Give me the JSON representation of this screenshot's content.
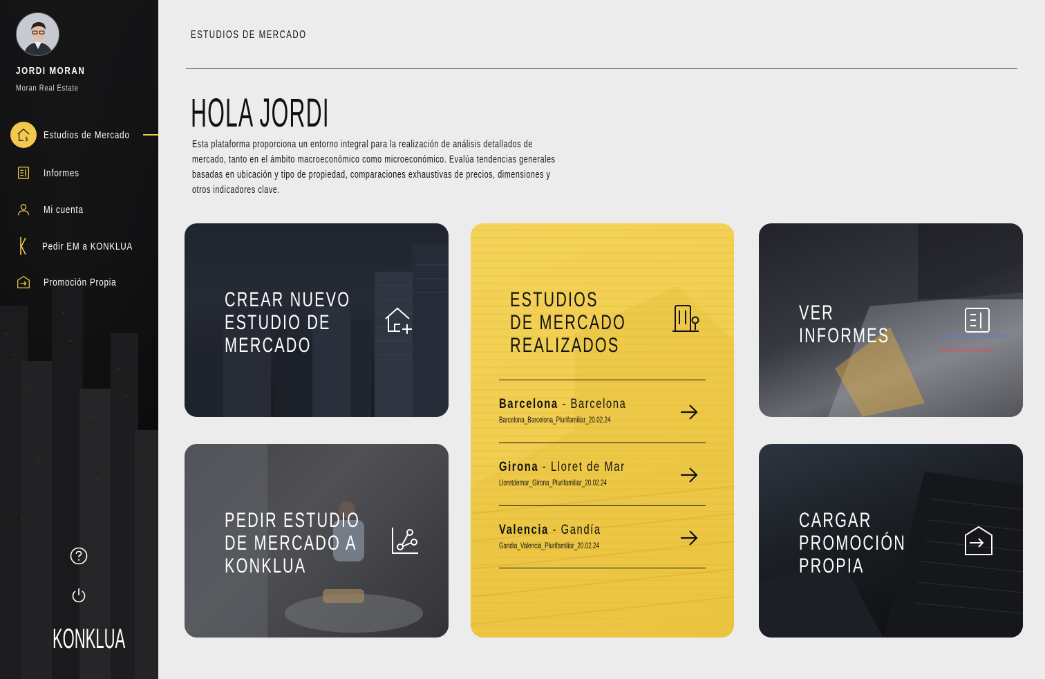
{
  "user": {
    "name": "JORDI MORAN",
    "company": "Moran Real Estate"
  },
  "nav": {
    "items": [
      {
        "label": "Estudios de Mercado",
        "icon": "house-dollar-icon",
        "active": true
      },
      {
        "label": "Informes",
        "icon": "document-icon"
      },
      {
        "label": "Mi cuenta",
        "icon": "user-icon"
      },
      {
        "label": "Pedir EM a KONKLUA",
        "icon": "konklua-k-icon"
      },
      {
        "label": "Promoción Propia",
        "icon": "house-enter-icon"
      }
    ]
  },
  "logo": "KONKLUA",
  "header": {
    "breadcrumb": "ESTUDIOS DE MERCADO"
  },
  "greeting": "HOLA JORDI",
  "intro": "Esta plataforma proporciona un entorno integral para la realización de análisis detallados de mercado, tanto en el ámbito macroeconómico como microeconómico. Evalúa tendencias generales basadas en ubicación y tipo de propiedad, comparaciones exhaustivas de precios, dimensiones y otros indicadores clave.",
  "cards": {
    "create": "CREAR NUEVO\nESTUDIO DE\nMERCADO",
    "request": "PEDIR ESTUDIO\nDE MERCADO A\nKONKLUA",
    "reports": "VER\nINFORMES",
    "upload": "CARGAR\nPROMOCIÓN\nPROPIA"
  },
  "studies": {
    "title": "ESTUDIOS\nDE MERCADO\nREALIZADOS",
    "rows": [
      {
        "province": "Barcelona",
        "separator": " - ",
        "town": "Barcelona",
        "file": "Barcelona_Barcelona_Plurifamiliar_20.02.24"
      },
      {
        "province": "Girona",
        "separator": " - ",
        "town": "Lloret de Mar",
        "file": "Lloretdemar_Girona_Plurifamiliar_20.02.24"
      },
      {
        "province": "Valencia",
        "separator": " - ",
        "town": "Gandía",
        "file": "Gandia_Valencia_Plurifamiliar_20.02.24"
      }
    ]
  },
  "colors": {
    "accent": "#f2c94c",
    "sidebar": "#111113",
    "background": "#ececec"
  }
}
